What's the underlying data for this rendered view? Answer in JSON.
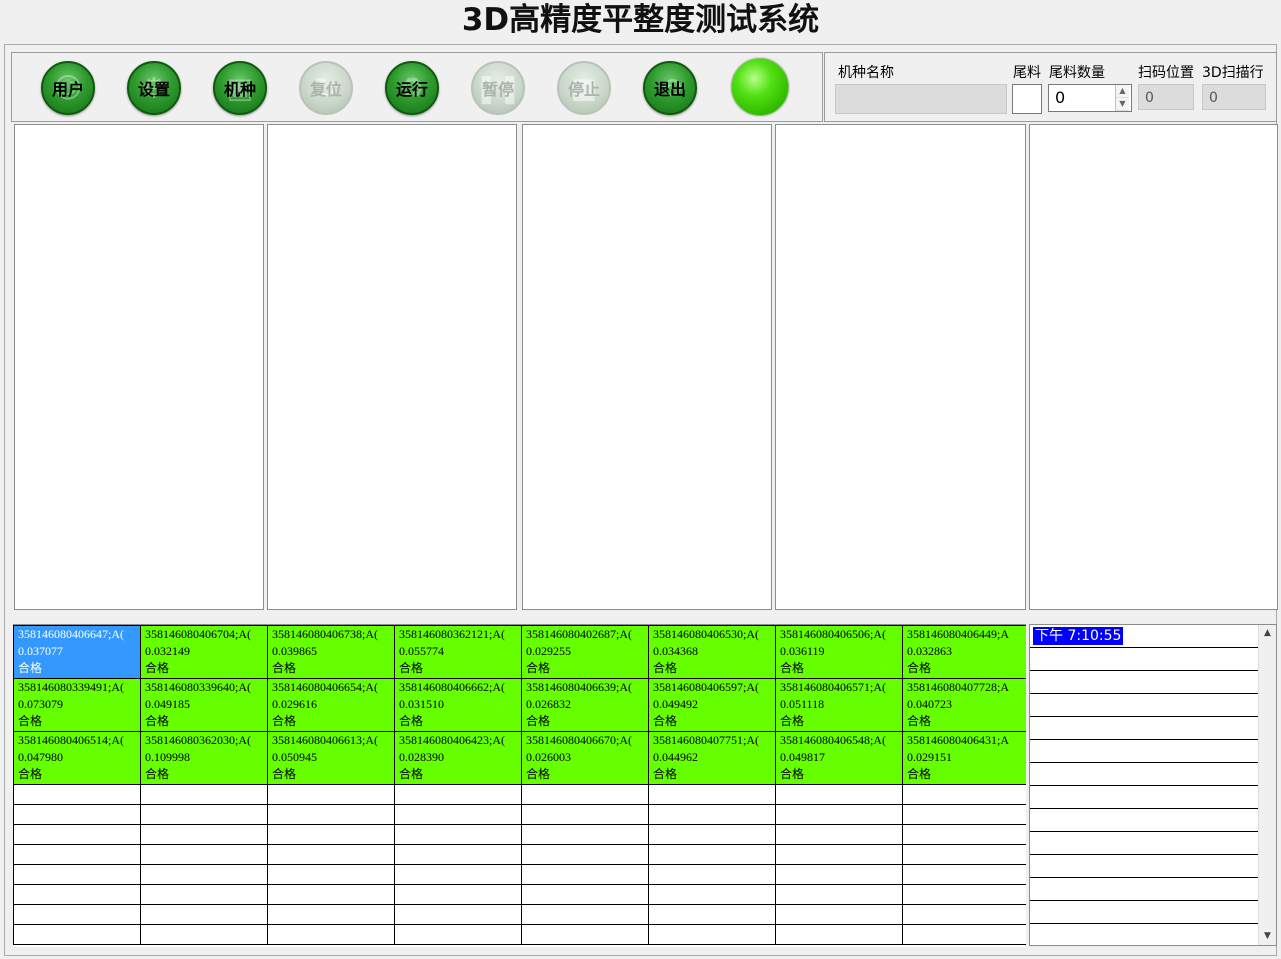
{
  "app": {
    "title": "3D高精度平整度测试系统"
  },
  "toolbar": {
    "buttons": [
      {
        "label": "用户",
        "icon": "user-icon",
        "enabled": true
      },
      {
        "label": "设置",
        "icon": "settings-icon",
        "enabled": true
      },
      {
        "label": "机种",
        "icon": "clipboard-icon",
        "enabled": true
      },
      {
        "label": "复位",
        "icon": "reset-icon",
        "enabled": false
      },
      {
        "label": "运行",
        "icon": "run-icon",
        "enabled": true
      },
      {
        "label": "暂停",
        "icon": "pause-icon",
        "enabled": false
      },
      {
        "label": "停止",
        "icon": "stop-icon",
        "enabled": false
      },
      {
        "label": "退出",
        "icon": "exit-icon",
        "enabled": true
      }
    ],
    "status_light_color": "#44dd00"
  },
  "info": {
    "model_name_label": "机种名称",
    "model_name_value": "",
    "tail_label": "尾料",
    "tail_count_label": "尾料数量",
    "tail_count_value": "0",
    "scan_pos_label": "扫码位置",
    "scan_pos_value": "0",
    "scan_row_label": "3D扫描行",
    "scan_row_value": "0"
  },
  "grid": {
    "rows": [
      [
        {
          "code": "358146080406647;A(",
          "value": "0.037077",
          "result": "合格",
          "selected": true
        },
        {
          "code": "358146080406704;A(",
          "value": "0.032149",
          "result": "合格"
        },
        {
          "code": "358146080406738;A(",
          "value": "0.039865",
          "result": "合格"
        },
        {
          "code": "358146080362121;A(",
          "value": "0.055774",
          "result": "合格"
        },
        {
          "code": "358146080402687;A(",
          "value": "0.029255",
          "result": "合格"
        },
        {
          "code": "358146080406530;A(",
          "value": "0.034368",
          "result": "合格"
        },
        {
          "code": "358146080406506;A(",
          "value": "0.036119",
          "result": "合格"
        },
        {
          "code": "358146080406449;A",
          "value": "0.032863",
          "result": "合格"
        }
      ],
      [
        {
          "code": "358146080339491;A(",
          "value": "0.073079",
          "result": "合格"
        },
        {
          "code": "358146080339640;A(",
          "value": "0.049185",
          "result": "合格"
        },
        {
          "code": "358146080406654;A(",
          "value": "0.029616",
          "result": "合格"
        },
        {
          "code": "358146080406662;A(",
          "value": "0.031510",
          "result": "合格"
        },
        {
          "code": "358146080406639;A(",
          "value": "0.026832",
          "result": "合格"
        },
        {
          "code": "358146080406597;A(",
          "value": "0.049492",
          "result": "合格"
        },
        {
          "code": "358146080406571;A(",
          "value": "0.051118",
          "result": "合格"
        },
        {
          "code": "358146080407728;A",
          "value": "0.040723",
          "result": "合格"
        }
      ],
      [
        {
          "code": "358146080406514;A(",
          "value": "0.047980",
          "result": "合格"
        },
        {
          "code": "358146080362030;A(",
          "value": "0.109998",
          "result": "合格"
        },
        {
          "code": "358146080406613;A(",
          "value": "0.050945",
          "result": "合格"
        },
        {
          "code": "358146080406423;A(",
          "value": "0.028390",
          "result": "合格"
        },
        {
          "code": "358146080406670;A(",
          "value": "0.026003",
          "result": "合格"
        },
        {
          "code": "358146080407751;A(",
          "value": "0.044962",
          "result": "合格"
        },
        {
          "code": "358146080406548;A(",
          "value": "0.049817",
          "result": "合格"
        },
        {
          "code": "358146080406431;A",
          "value": "0.029151",
          "result": "合格"
        }
      ]
    ],
    "pass_color": "#66ff00",
    "selected_color": "#3399ff"
  },
  "log": {
    "entries": [
      "下午 7:10:55"
    ]
  }
}
